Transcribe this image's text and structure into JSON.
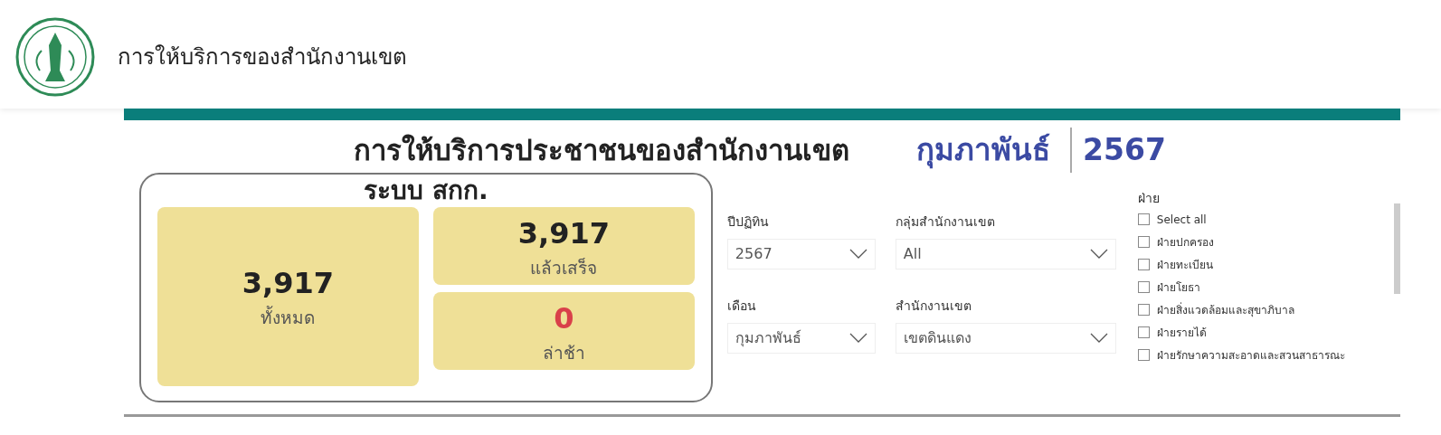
{
  "header": {
    "title": "การให้บริการของสำนักงานเขต"
  },
  "report": {
    "title": "การให้บริการประชาชนของสำนักงานเขต",
    "month": "กุมภาพันธ์",
    "year": "2567"
  },
  "kpi_panel": {
    "title": "ระบบ สกก.",
    "tiles": [
      {
        "kind": "total",
        "value": "3,917",
        "label": "ทั้งหมด"
      },
      {
        "kind": "done",
        "value": "3,917",
        "label": "แล้วเสร็จ"
      },
      {
        "kind": "late",
        "value": "0",
        "label": "ล่าช้า"
      }
    ]
  },
  "filters": [
    {
      "label": "ปีปฏิทิน",
      "value": "2567"
    },
    {
      "label": "กลุ่มสำนักงานเขต",
      "value": "All"
    },
    {
      "label": "เดือน",
      "value": "กุมภาพันธ์"
    },
    {
      "label": "สำนักงานเขต",
      "value": "เขตดินแดง"
    }
  ],
  "division_filter": {
    "title": "ฝ่าย",
    "options": [
      {
        "label": "Select all",
        "checked": false
      },
      {
        "label": "ฝ่ายปกครอง",
        "checked": false
      },
      {
        "label": "ฝ่ายทะเบียน",
        "checked": false
      },
      {
        "label": "ฝ่ายโยธา",
        "checked": false
      },
      {
        "label": "ฝ่ายสิ่งแวดล้อมและสุขาภิบาล",
        "checked": false
      },
      {
        "label": "ฝ่ายรายได้",
        "checked": false
      },
      {
        "label": "ฝ่ายรักษาความสะอาดและสวนสาธารณะ",
        "checked": false
      }
    ]
  }
}
